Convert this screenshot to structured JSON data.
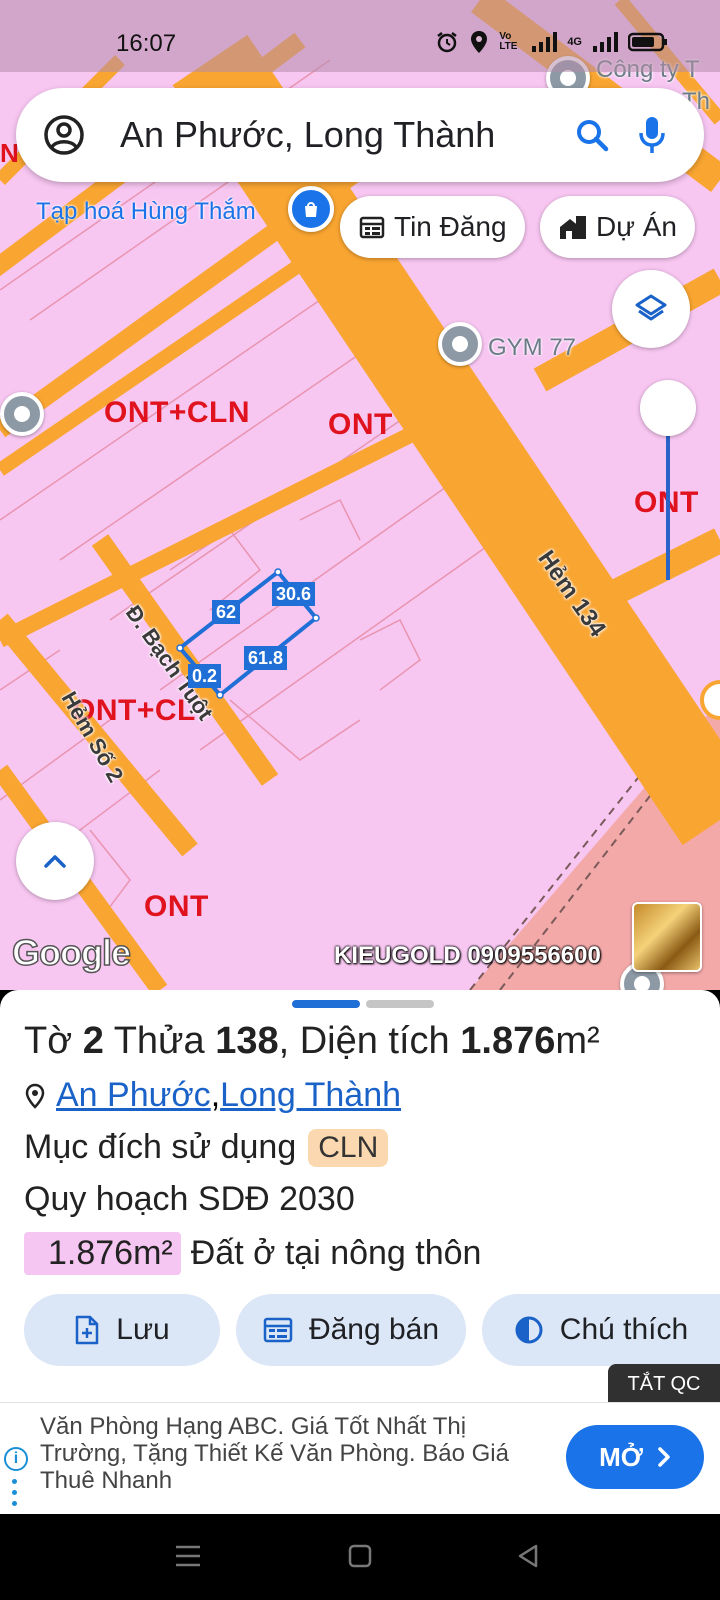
{
  "status_bar": {
    "time": "16:07",
    "network": "4G",
    "volte": "Vo LTE"
  },
  "search": {
    "query": "An Phước, Long Thành"
  },
  "chips": {
    "listings": "Tin Đăng",
    "projects": "Dự Án"
  },
  "map": {
    "zones": [
      "ONT+CLN",
      "ONT",
      "ONT",
      "ONT+CL",
      "ONT"
    ],
    "roads": {
      "hem_134": "Hẻm 134",
      "bach_tuot": "Đ. Bạch Tuột",
      "hem_so_2": "Hẻm Số 2"
    },
    "pois": {
      "hung_tham": "Tạp hoá Hùng Thắm",
      "gym": "GYM 77",
      "company": "Công ty T",
      "company2": "Th"
    },
    "dimensions": [
      "62",
      "30.6",
      "61.8",
      "0.2"
    ],
    "edge_letter": "N",
    "google": "Google",
    "watermark": "KIEUGOLD 0909556600"
  },
  "parcel": {
    "sheet_prefix": "Tờ ",
    "sheet_no": "2",
    "plot_prefix": " Thửa ",
    "plot_no": "138",
    "area_prefix": ", Diện tích ",
    "area_value": "1.876",
    "area_unit": "m²",
    "ward": "An Phước",
    "separator": ", ",
    "district": "Long Thành",
    "purpose_label": "Mục đích sử dụng",
    "purpose_code": "CLN",
    "plan_label": "Quy hoạch SDĐ 2030",
    "plan_area": "1.876m²",
    "plan_use": "Đất ở tại nông thôn"
  },
  "actions": {
    "save": "Lưu",
    "post": "Đăng bán",
    "legend": "Chú thích"
  },
  "hide_ads": "TẮT QC",
  "ad": {
    "text": "Văn Phòng Hạng ABC. Giá Tốt Nhất Thị Trường, Tặng Thiết Kế Văn Phòng. Báo Giá Thuê Nhanh",
    "cta": "MỞ"
  },
  "colors": {
    "accent": "#1a73e8",
    "zone_red": "#e0121e",
    "road_orange": "#f9a531",
    "land_pink": "#f7c6f1"
  }
}
